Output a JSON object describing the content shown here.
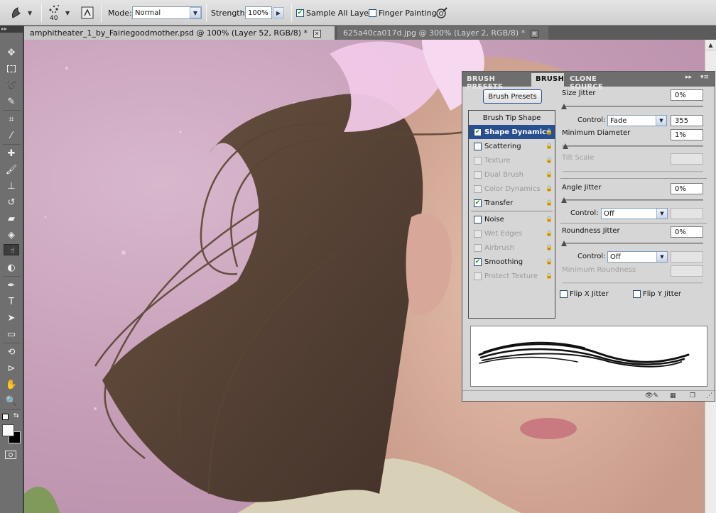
{
  "options_bar": {
    "brush_size": "40",
    "mode_label": "Mode:",
    "mode_value": "Normal",
    "strength_label": "Strength:",
    "strength_value": "100%",
    "sample_all_layers_label": "Sample All Layers",
    "sample_all_layers_checked": true,
    "finger_painting_label": "Finger Painting",
    "finger_painting_checked": false
  },
  "tabs": [
    {
      "label": "amphitheater_1_by_Fairiegoodmother.psd @ 100% (Layer 52, RGB/8) *",
      "active": true
    },
    {
      "label": "625a40ca017d.jpg @ 300% (Layer 2, RGB/8) *",
      "active": false
    }
  ],
  "panel": {
    "tabs": [
      "BRUSH PRESETS",
      "BRUSH",
      "CLONE SOURCE"
    ],
    "active_tab": "BRUSH",
    "brush_presets_button": "Brush Presets",
    "settings": [
      {
        "label": "Brush Tip Shape",
        "checkbox": false,
        "enabled": true
      },
      {
        "label": "Shape Dynamics",
        "checked": true,
        "enabled": true,
        "selected": true
      },
      {
        "label": "Scattering",
        "checked": false,
        "enabled": true
      },
      {
        "label": "Texture",
        "checked": false,
        "enabled": false
      },
      {
        "label": "Dual Brush",
        "checked": false,
        "enabled": false
      },
      {
        "label": "Color Dynamics",
        "checked": false,
        "enabled": false
      },
      {
        "label": "Transfer",
        "checked": true,
        "enabled": true
      },
      {
        "label": "Noise",
        "checked": false,
        "enabled": true
      },
      {
        "label": "Wet Edges",
        "checked": false,
        "enabled": false
      },
      {
        "label": "Airbrush",
        "checked": false,
        "enabled": false
      },
      {
        "label": "Smoothing",
        "checked": true,
        "enabled": true
      },
      {
        "label": "Protect Texture",
        "checked": false,
        "enabled": false
      }
    ],
    "size_jitter": {
      "label": "Size Jitter",
      "value": "0%"
    },
    "size_control": {
      "label": "Control:",
      "value": "Fade",
      "fade_steps": "355"
    },
    "minimum_diameter": {
      "label": "Minimum Diameter",
      "value": "1%"
    },
    "tilt_scale": {
      "label": "Tilt Scale"
    },
    "angle_jitter": {
      "label": "Angle Jitter",
      "value": "0%"
    },
    "angle_control": {
      "label": "Control:",
      "value": "Off"
    },
    "roundness_jitter": {
      "label": "Roundness Jitter",
      "value": "0%"
    },
    "roundness_control": {
      "label": "Control:",
      "value": "Off"
    },
    "minimum_roundness": {
      "label": "Minimum Roundness"
    },
    "flip_x": {
      "label": "Flip X Jitter",
      "checked": false
    },
    "flip_y": {
      "label": "Flip Y Jitter",
      "checked": false
    }
  },
  "colors": {
    "accent_selected": "#2a4f8e",
    "canvas_pink": "#c79fb8",
    "hair_brown": "#5a4533"
  }
}
